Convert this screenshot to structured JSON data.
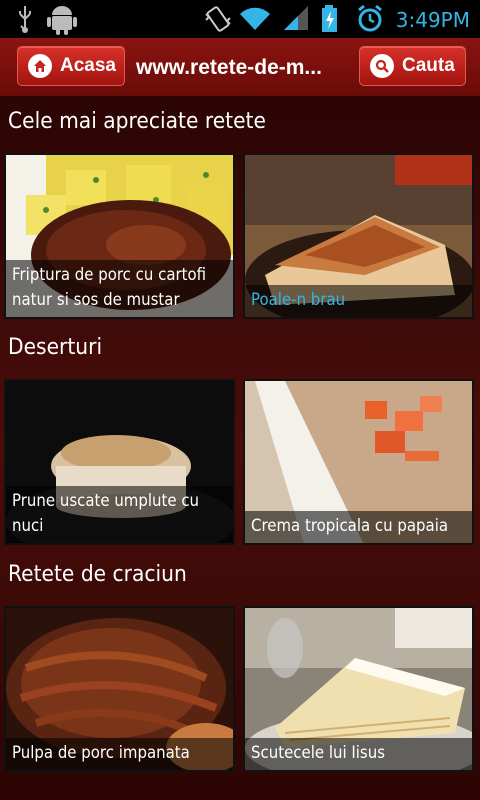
{
  "status_bar": {
    "time": "3:49PM",
    "icons": [
      "usb-icon",
      "android-debug-icon",
      "vibrate-icon",
      "wifi-icon",
      "signal-icon",
      "battery-charging-icon",
      "alarm-icon"
    ]
  },
  "header": {
    "home_label": "Acasa",
    "site_title": "www.retete-de-m...",
    "search_label": "Cauta"
  },
  "colors": {
    "header_red": "#8a1410",
    "button_red": "#c8241f",
    "background": "#3a0a08",
    "link_blue": "#33b5e5"
  },
  "sections": [
    {
      "title": "Cele mai apreciate retete",
      "recipes": [
        {
          "caption": "Friptura de porc cu cartofi natur si sos de mustar"
        },
        {
          "caption": "Poale-n brau"
        }
      ]
    },
    {
      "title": "Deserturi",
      "recipes": [
        {
          "caption": "Prune uscate umplute cu nuci"
        },
        {
          "caption": "Crema tropicala cu papaia"
        }
      ]
    },
    {
      "title": "Retete de craciun",
      "recipes": [
        {
          "caption": "Pulpa de porc impanata"
        },
        {
          "caption": "Scutecele lui Iisus"
        }
      ]
    }
  ]
}
